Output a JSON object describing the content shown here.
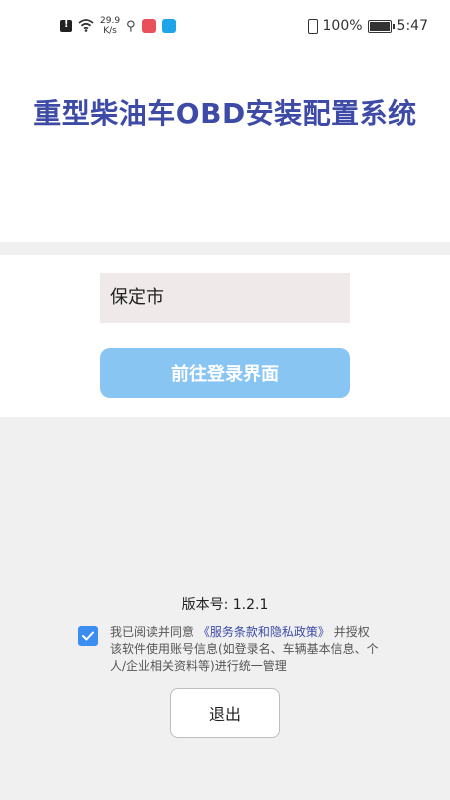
{
  "status_bar": {
    "net_speed_value": "29.9",
    "net_speed_unit": "K/s",
    "battery_percent": "100%",
    "time": "5:47"
  },
  "header": {
    "title": "重型柴油车OBD安装配置系统"
  },
  "form": {
    "city_value": "保定市",
    "login_button_label": "前往登录界面"
  },
  "footer": {
    "version_label": "版本号:",
    "version_value": "1.2.1",
    "agree_prefix": "我已阅读并同意",
    "policy_link": "《服务条款和隐私政策》",
    "agree_body": "并授权该软件使用账号信息(如登录名、车辆基本信息、个人/企业相关资料等)进行统一管理",
    "agree_checked": true,
    "exit_button_label": "退出"
  },
  "colors": {
    "title": "#3d4aa6",
    "login_button": "#89c5f3",
    "checkbox": "#3b8ef0",
    "link": "#3d4aa6"
  },
  "icons": [
    "alert-icon",
    "wifi-icon",
    "usb-icon",
    "app-icon-red",
    "app-icon-blue",
    "vibrate-icon",
    "battery-icon"
  ]
}
